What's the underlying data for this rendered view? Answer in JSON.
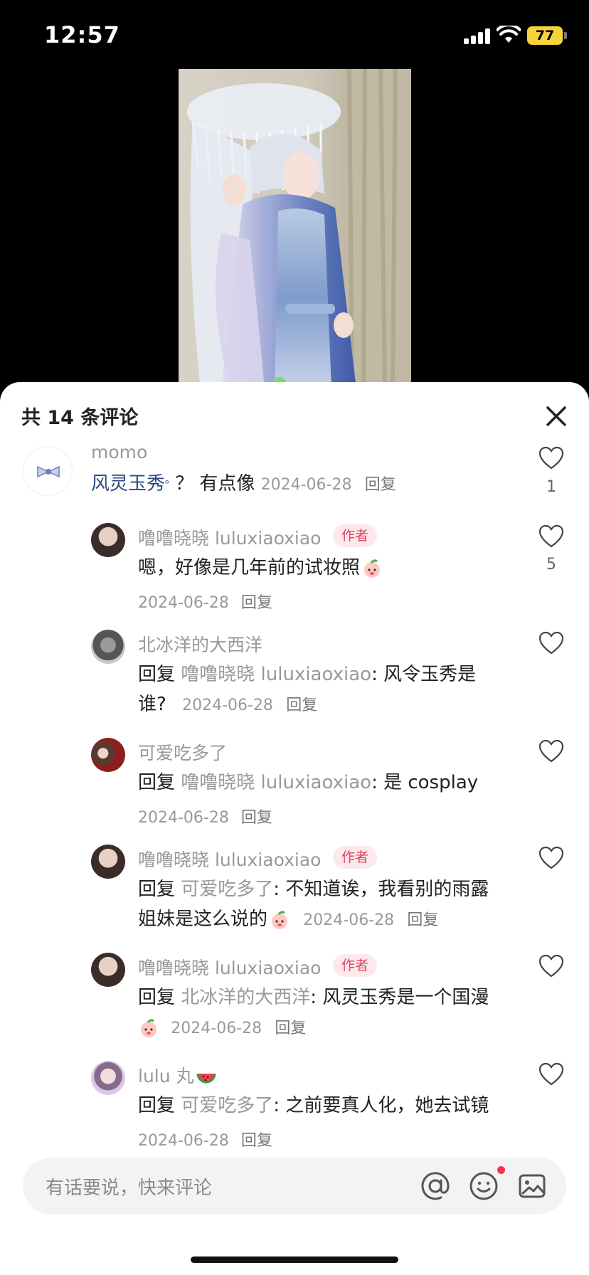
{
  "status_bar": {
    "time": "12:57",
    "battery": "77"
  },
  "comments_panel": {
    "title": "共 14 条评论",
    "input_placeholder": "有话要说，快来评论"
  },
  "comments": [
    {
      "user": "momo",
      "link_text": "风灵玉秀",
      "text": "？ 有点像",
      "date": "2024-06-28",
      "reply": "回复",
      "likes": "1"
    },
    {
      "user": "噜噜晓晓 luluxiaoxiao",
      "tag": "作者",
      "text": "嗯，好像是几年前的试妆照",
      "date": "2024-06-28",
      "reply": "回复",
      "likes": "5"
    },
    {
      "user": "北冰洋的大西洋",
      "reply_prefix": "回复",
      "reply_to": "噜噜晓晓 luluxiaoxiao",
      "text_line1": ": 风令玉秀是",
      "text_line2": "谁?",
      "date": "2024-06-28",
      "reply": "回复"
    },
    {
      "user": "可爱吃多了",
      "reply_prefix": "回复",
      "reply_to": "噜噜晓晓 luluxiaoxiao",
      "text_line1": ": 是 cosplay",
      "date": "2024-06-28",
      "reply": "回复"
    },
    {
      "user": "噜噜晓晓 luluxiaoxiao",
      "tag": "作者",
      "reply_prefix": "回复",
      "reply_to": "可爱吃多了",
      "text_line1": ": 不知道诶，我看别的雨露",
      "text_line2": "姐妹是这么说的",
      "date": "2024-06-28",
      "reply": "回复"
    },
    {
      "user": "噜噜晓晓 luluxiaoxiao",
      "tag": "作者",
      "reply_prefix": "回复",
      "reply_to": "北冰洋的大西洋",
      "text_line1": ": 风灵玉秀是一个国漫",
      "date": "2024-06-28",
      "reply": "回复"
    },
    {
      "user": "lulu 丸",
      "reply_prefix": "回复",
      "reply_to": "可爱吃多了",
      "text_line1": ": 之前要真人化，她去试镜",
      "date": "2024-06-28",
      "reply": "回复"
    }
  ],
  "icons": [
    "signal-icon",
    "wifi-icon",
    "battery-icon",
    "close-icon",
    "heart-icon",
    "at-icon",
    "emoji-icon",
    "image-icon",
    "peach-sticker-icon",
    "watermelon-icon",
    "search-link-icon"
  ],
  "colors": {
    "author_tag_bg": "#fde9ec",
    "author_tag_text": "#e0405c",
    "link_blue": "#2a4a7f",
    "notification_dot": "#ff2d4f"
  }
}
